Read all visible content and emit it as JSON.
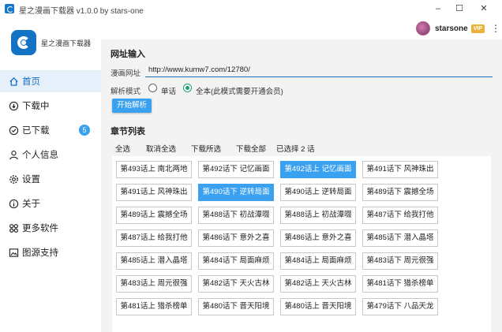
{
  "window": {
    "title": "星之漫画下载器 v1.0.0 by stars-one",
    "controls": [
      "–",
      "☐",
      "✕"
    ]
  },
  "user": {
    "name": "starsone",
    "vip_label": "VIP",
    "more_icon": "⋮"
  },
  "sidebar": {
    "logo_text": "星之漫画下载器",
    "items": [
      {
        "label": "首页",
        "icon": "home-icon",
        "active": true
      },
      {
        "label": "下载中",
        "icon": "download-icon"
      },
      {
        "label": "已下载",
        "icon": "check-circle-icon",
        "badge": "5"
      },
      {
        "label": "个人信息",
        "icon": "user-icon"
      },
      {
        "label": "设置",
        "icon": "gear-icon"
      },
      {
        "label": "关于",
        "icon": "info-icon"
      },
      {
        "label": "更多软件",
        "icon": "grid-icon"
      },
      {
        "label": "图源支持",
        "icon": "image-icon"
      }
    ]
  },
  "input_section": {
    "title": "网址输入",
    "url_label": "漫画网址",
    "url_value": "http://www.kumw7.com/12780/",
    "mode_label": "解析模式",
    "mode_single": "单话",
    "mode_all": "全本(此模式需要开通会员)",
    "selected_mode": "all",
    "parse_button": "开始解析"
  },
  "chapter_section": {
    "title": "章节列表",
    "actions": [
      "全选",
      "取消全选",
      "下载所选",
      "下载全部"
    ],
    "selected_info": "已选择 2 话",
    "chapters": [
      {
        "label": "第493话上 南北两地",
        "selected": false
      },
      {
        "label": "第492话下 记忆画面",
        "selected": false
      },
      {
        "label": "第492话上 记忆画面",
        "selected": true
      },
      {
        "label": "第491话下 风神珠出",
        "selected": false
      },
      {
        "label": "第491话上 风神珠出",
        "selected": false
      },
      {
        "label": "第490话下 逆转局面",
        "selected": true
      },
      {
        "label": "第490话上 逆转局面",
        "selected": false
      },
      {
        "label": "第489话下 震撼全场",
        "selected": false
      },
      {
        "label": "第489话上 震撼全场",
        "selected": false
      },
      {
        "label": "第488话下 初战潭啜",
        "selected": false
      },
      {
        "label": "第488话上 初战潭啜",
        "selected": false
      },
      {
        "label": "第487话下 给我打他",
        "selected": false
      },
      {
        "label": "第487话上 给我打他",
        "selected": false
      },
      {
        "label": "第486话下 意外之喜",
        "selected": false
      },
      {
        "label": "第486话上 意外之喜",
        "selected": false
      },
      {
        "label": "第485话下 潜入晶塔",
        "selected": false
      },
      {
        "label": "第485话上 潜入晶塔",
        "selected": false
      },
      {
        "label": "第484话下 局面麻烦",
        "selected": false
      },
      {
        "label": "第484话上 局面麻烦",
        "selected": false
      },
      {
        "label": "第483话下 周元很强",
        "selected": false
      },
      {
        "label": "第483话上 周元很强",
        "selected": false
      },
      {
        "label": "第482话下 天火古林",
        "selected": false
      },
      {
        "label": "第482话上 天火古林",
        "selected": false
      },
      {
        "label": "第481话下 猎杀榜单",
        "selected": false
      },
      {
        "label": "第481话上 猎杀榜单",
        "selected": false
      },
      {
        "label": "第480话下 晋天阳境",
        "selected": false
      },
      {
        "label": "第480话上 晋天阳境",
        "selected": false
      },
      {
        "label": "第479话下 八品天龙",
        "selected": false
      }
    ]
  },
  "colors": {
    "accent": "#3aa0f0",
    "active_nav_bg": "#e6f0fb",
    "vip": "#e8b33a",
    "radio_checked": "#1aa06a"
  }
}
